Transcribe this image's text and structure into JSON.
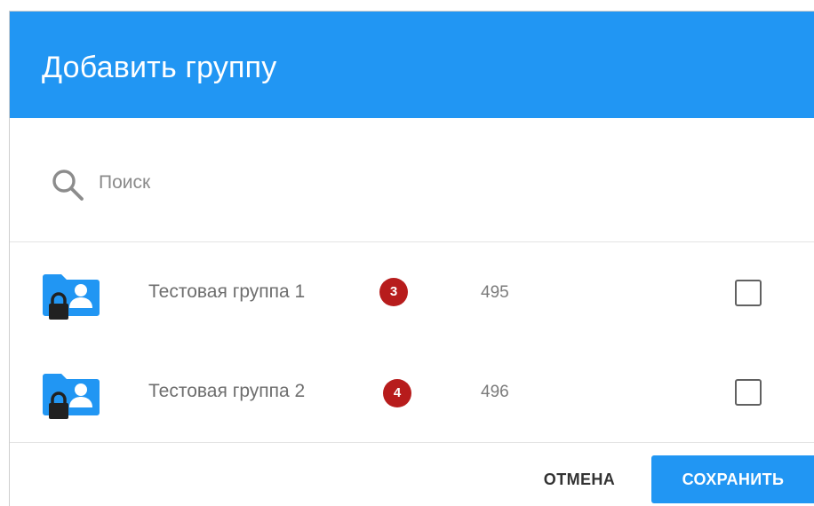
{
  "dialog": {
    "title": "Добавить группу"
  },
  "search": {
    "icon": "search-icon",
    "placeholder": "Поиск",
    "value": ""
  },
  "groups": [
    {
      "name": "Тестовая группа 1",
      "badge": "3",
      "id": "495",
      "icon": "locked-group-folder-icon",
      "checked": false
    },
    {
      "name": "Тестовая группа 2",
      "badge": "4",
      "id": "496",
      "icon": "locked-group-folder-icon",
      "checked": false
    }
  ],
  "footer": {
    "cancel_label": "ОТМЕНА",
    "save_label": "СОХРАНИТЬ"
  },
  "colors": {
    "accent": "#2196f3",
    "badge": "#b71c1c",
    "folder": "#2196f3",
    "lock": "#212121"
  }
}
